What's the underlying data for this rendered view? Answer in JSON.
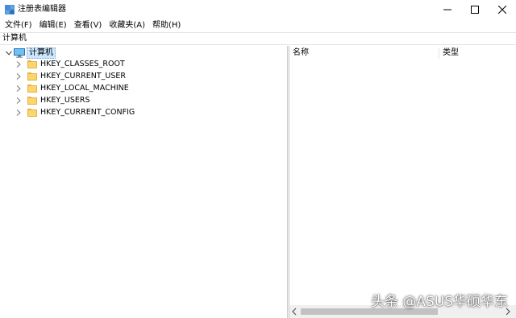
{
  "window": {
    "title": "注册表编辑器"
  },
  "menu": {
    "items": [
      "文件(F)",
      "编辑(E)",
      "查看(V)",
      "收藏夹(A)",
      "帮助(H)"
    ]
  },
  "address": {
    "path": "计算机"
  },
  "tree": {
    "root": "计算机",
    "keys": [
      "HKEY_CLASSES_ROOT",
      "HKEY_CURRENT_USER",
      "HKEY_LOCAL_MACHINE",
      "HKEY_USERS",
      "HKEY_CURRENT_CONFIG"
    ]
  },
  "list": {
    "columns": [
      "名称",
      "类型"
    ]
  },
  "watermark": {
    "text": "头条 @ASUS华硕华东"
  },
  "colors": {
    "selection": "#cce8ff",
    "folder": "#fcd56b",
    "icon_blue": "#1a73c8"
  }
}
